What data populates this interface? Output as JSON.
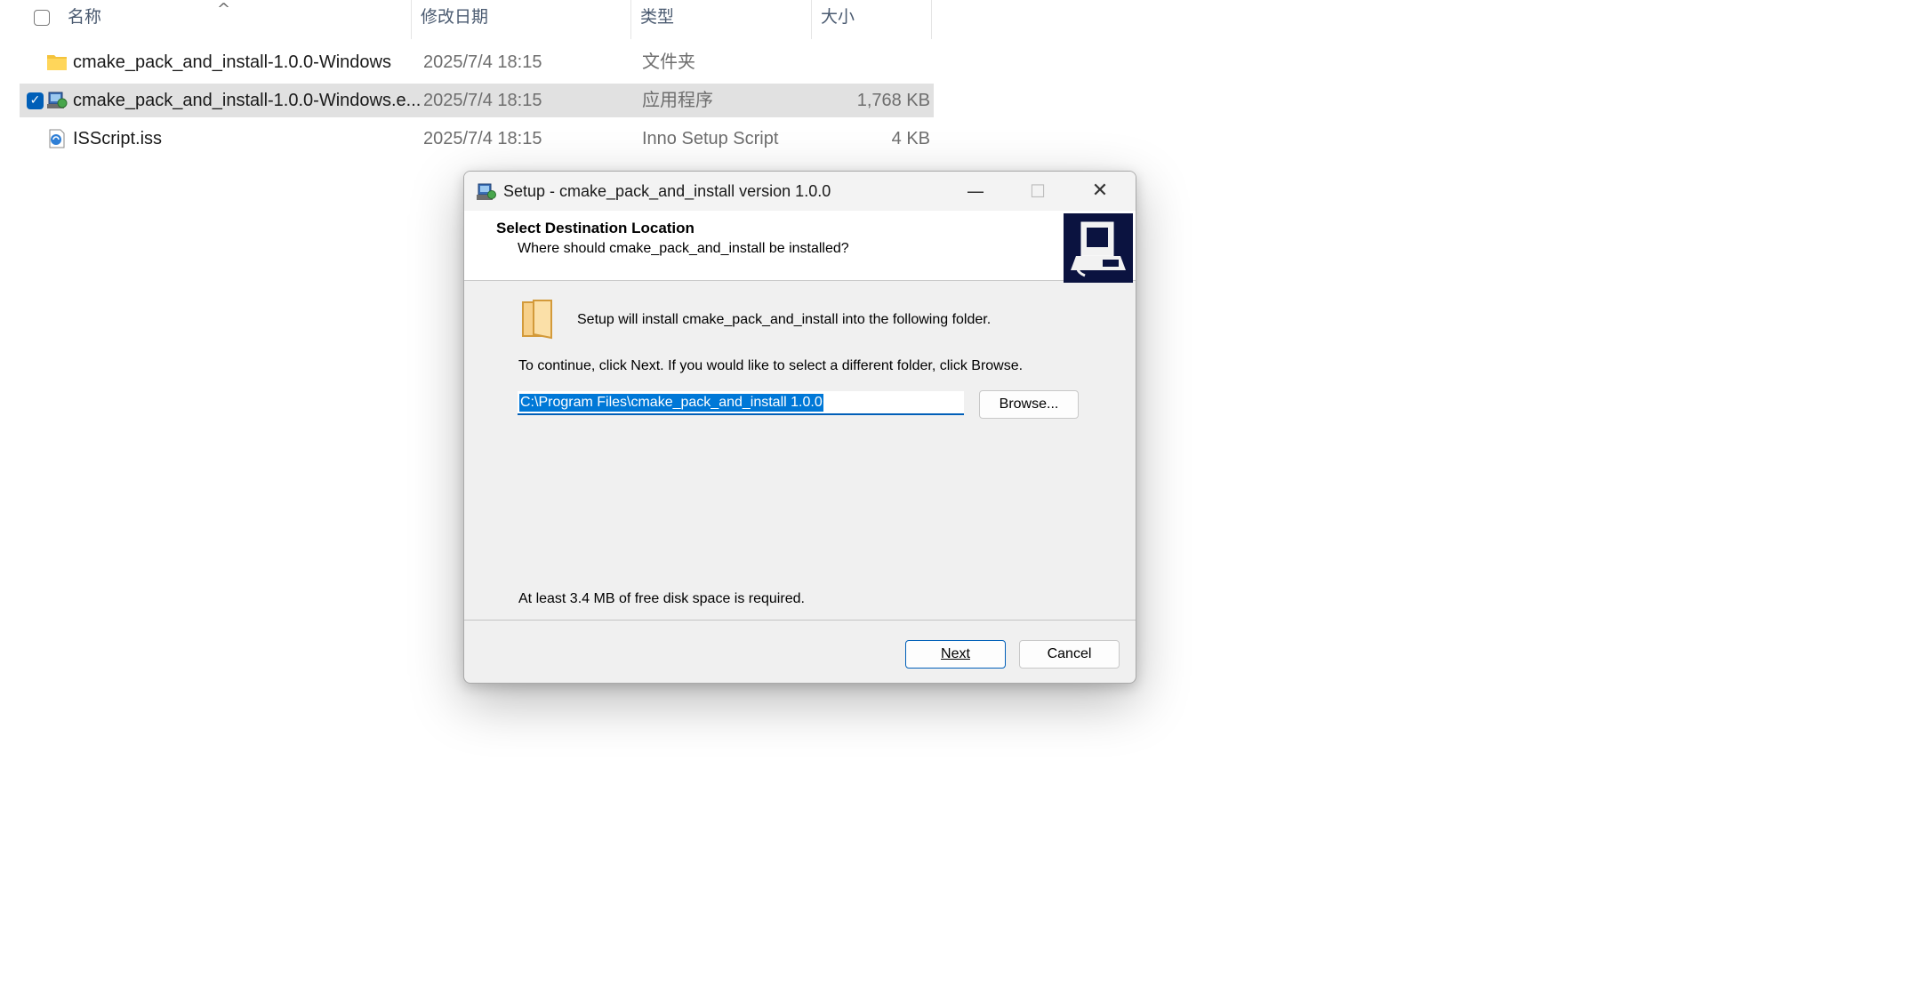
{
  "explorer": {
    "columns": {
      "name": "名称",
      "date": "修改日期",
      "type": "类型",
      "size": "大小"
    },
    "sort_caret": "^",
    "files": [
      {
        "name": "cmake_pack_and_install-1.0.0-Windows",
        "date": "2025/7/4 18:15",
        "type": "文件夹",
        "size": "",
        "icon": "folder-icon",
        "selected": false
      },
      {
        "name": "cmake_pack_and_install-1.0.0-Windows.e...",
        "date": "2025/7/4 18:15",
        "type": "应用程序",
        "size": "1,768 KB",
        "icon": "setup-exe-icon",
        "selected": true
      },
      {
        "name": "ISScript.iss",
        "date": "2025/7/4 18:15",
        "type": "Inno Setup Script",
        "size": "4 KB",
        "icon": "inno-script-icon",
        "selected": false
      }
    ]
  },
  "dialog": {
    "title": "Setup - cmake_pack_and_install version 1.0.0",
    "controls": {
      "minimize": "—",
      "maximize": "☐",
      "close": "✕"
    },
    "banner": {
      "title": "Select Destination Location",
      "subtitle": "Where should cmake_pack_and_install be installed?"
    },
    "intro": "Setup will install cmake_pack_and_install into the following folder.",
    "instructions": "To continue, click Next. If you would like to select a different folder, click Browse.",
    "path": "C:\\Program Files\\cmake_pack_and_install 1.0.0",
    "browse_label": "Browse...",
    "disk_space": "At least 3.4 MB of free disk space is required.",
    "next_label": "Next",
    "cancel_label": "Cancel"
  },
  "colors": {
    "accent": "#005fb8",
    "selection": "#0078d7",
    "row_selected": "#e1e1e1"
  }
}
